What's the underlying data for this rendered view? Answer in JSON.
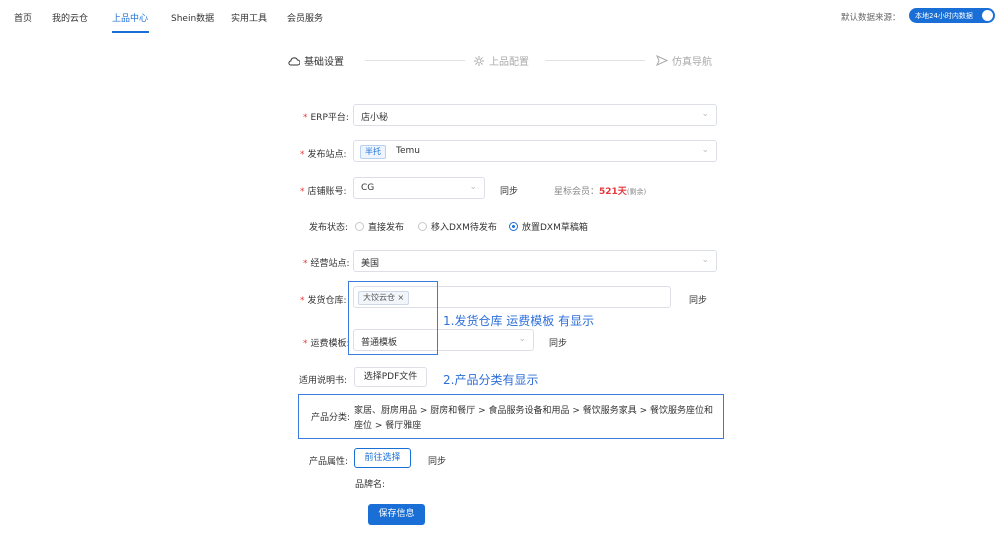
{
  "nav": {
    "items": [
      "首页",
      "我的云仓",
      "上品中心",
      "Shein数据",
      "实用工具",
      "会员服务"
    ],
    "active_index": 2,
    "data_source_label": "默认数据来源：",
    "data_source_value": "本地24小时内数据"
  },
  "steps": [
    {
      "label": "基础设置",
      "icon": "cloud-icon",
      "active": true
    },
    {
      "label": "上品配置",
      "icon": "gear-icon",
      "active": false
    },
    {
      "label": "仿真导航",
      "icon": "send-icon",
      "active": false
    }
  ],
  "form": {
    "erp": {
      "label": "ERP平台",
      "value": "店小秘"
    },
    "site": {
      "label": "发布站点",
      "tag": "半托",
      "value": "Temu"
    },
    "shop": {
      "label": "店铺账号",
      "value": "CG",
      "sync": "同步",
      "member_label": "星标会员：",
      "member_value": "521天",
      "member_suffix": "(剩余)"
    },
    "status": {
      "label": "发布状态",
      "options": [
        "直接发布",
        "移入DXM待发布",
        "放置DXM草稿箱"
      ],
      "selected": 2
    },
    "ops_site": {
      "label": "经营站点",
      "value": "美国"
    },
    "warehouse": {
      "label": "发货仓库",
      "tag": "大饺云仓",
      "sync": "同步"
    },
    "freight": {
      "label": "运费模板",
      "value": "普通模板",
      "sync": "同步"
    },
    "manual": {
      "label": "适用说明书",
      "button": "选择PDF文件"
    },
    "category": {
      "label": "产品分类",
      "value": "家居、厨房用品 > 厨房和餐厅 > 食品服务设备和用品 > 餐饮服务家具 > 餐饮服务座位和座位 > 餐厅雅座"
    },
    "attrs": {
      "label": "产品属性",
      "button": "前往选择",
      "sync": "同步",
      "brand_label": "品牌名:"
    },
    "save": "保存信息"
  },
  "annotations": {
    "note1": "1.发货仓库 运费模板 有显示",
    "note2": "2.产品分类有显示"
  },
  "colors": {
    "accent": "#1a6fd6",
    "annotation": "#3b7be0",
    "required": "#e4393c"
  }
}
